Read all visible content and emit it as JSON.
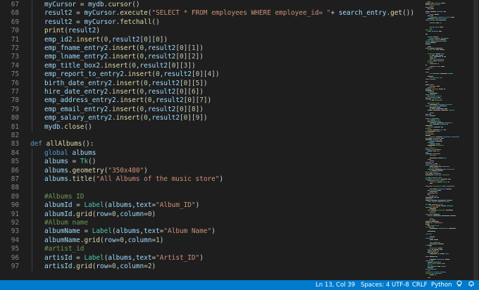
{
  "editor": {
    "lines": [
      {
        "num": "67",
        "indent": 1,
        "tokens": [
          [
            "var",
            "myCursor"
          ],
          [
            "p",
            " = "
          ],
          [
            "var",
            "mydb"
          ],
          [
            "p",
            "."
          ],
          [
            "fn",
            "cursor"
          ],
          [
            "p",
            "()"
          ]
        ]
      },
      {
        "num": "68",
        "indent": 1,
        "tokens": [
          [
            "var",
            "result2"
          ],
          [
            "p",
            " = "
          ],
          [
            "var",
            "myCursor"
          ],
          [
            "p",
            "."
          ],
          [
            "fn",
            "execute"
          ],
          [
            "p",
            "("
          ],
          [
            "str",
            "\"SELECT * FROM employees WHERE employee_id= \""
          ],
          [
            "p",
            "+ "
          ],
          [
            "var",
            "search_entry"
          ],
          [
            "p",
            "."
          ],
          [
            "fn",
            "get"
          ],
          [
            "p",
            "())"
          ]
        ]
      },
      {
        "num": "69",
        "indent": 1,
        "tokens": [
          [
            "var",
            "result2"
          ],
          [
            "p",
            " = "
          ],
          [
            "var",
            "myCursor"
          ],
          [
            "p",
            "."
          ],
          [
            "fn",
            "fetchall"
          ],
          [
            "p",
            "()"
          ]
        ]
      },
      {
        "num": "70",
        "indent": 1,
        "tokens": [
          [
            "fn",
            "print"
          ],
          [
            "p",
            "("
          ],
          [
            "var",
            "result2"
          ],
          [
            "p",
            ")"
          ]
        ]
      },
      {
        "num": "71",
        "indent": 1,
        "tokens": [
          [
            "var",
            "emp_id2"
          ],
          [
            "p",
            "."
          ],
          [
            "fn",
            "insert"
          ],
          [
            "p",
            "("
          ],
          [
            "num",
            "0"
          ],
          [
            "p",
            ","
          ],
          [
            "var",
            "result2"
          ],
          [
            "p",
            "["
          ],
          [
            "num",
            "0"
          ],
          [
            "p",
            "]["
          ],
          [
            "num",
            "0"
          ],
          [
            "p",
            "])"
          ]
        ]
      },
      {
        "num": "72",
        "indent": 1,
        "tokens": [
          [
            "var",
            "emp_fname_entry2"
          ],
          [
            "p",
            "."
          ],
          [
            "fn",
            "insert"
          ],
          [
            "p",
            "("
          ],
          [
            "num",
            "0"
          ],
          [
            "p",
            ","
          ],
          [
            "var",
            "result2"
          ],
          [
            "p",
            "["
          ],
          [
            "num",
            "0"
          ],
          [
            "p",
            "]["
          ],
          [
            "num",
            "1"
          ],
          [
            "p",
            "])"
          ]
        ]
      },
      {
        "num": "73",
        "indent": 1,
        "tokens": [
          [
            "var",
            "emp_lname_entry2"
          ],
          [
            "p",
            "."
          ],
          [
            "fn",
            "insert"
          ],
          [
            "p",
            "("
          ],
          [
            "num",
            "0"
          ],
          [
            "p",
            ","
          ],
          [
            "var",
            "result2"
          ],
          [
            "p",
            "["
          ],
          [
            "num",
            "0"
          ],
          [
            "p",
            "]["
          ],
          [
            "num",
            "2"
          ],
          [
            "p",
            "])"
          ]
        ]
      },
      {
        "num": "74",
        "indent": 1,
        "tokens": [
          [
            "var",
            "emp_title_box2"
          ],
          [
            "p",
            "."
          ],
          [
            "fn",
            "insert"
          ],
          [
            "p",
            "("
          ],
          [
            "num",
            "0"
          ],
          [
            "p",
            ","
          ],
          [
            "var",
            "result2"
          ],
          [
            "p",
            "["
          ],
          [
            "num",
            "0"
          ],
          [
            "p",
            "]["
          ],
          [
            "num",
            "3"
          ],
          [
            "p",
            "])"
          ]
        ]
      },
      {
        "num": "75",
        "indent": 1,
        "tokens": [
          [
            "var",
            "emp_report_to_entry2"
          ],
          [
            "p",
            "."
          ],
          [
            "fn",
            "insert"
          ],
          [
            "p",
            "("
          ],
          [
            "num",
            "0"
          ],
          [
            "p",
            ","
          ],
          [
            "var",
            "result2"
          ],
          [
            "p",
            "["
          ],
          [
            "num",
            "0"
          ],
          [
            "p",
            "]["
          ],
          [
            "num",
            "4"
          ],
          [
            "p",
            "])"
          ]
        ]
      },
      {
        "num": "76",
        "indent": 1,
        "tokens": [
          [
            "var",
            "birth_date_entry2"
          ],
          [
            "p",
            "."
          ],
          [
            "fn",
            "insert"
          ],
          [
            "p",
            "("
          ],
          [
            "num",
            "0"
          ],
          [
            "p",
            ","
          ],
          [
            "var",
            "result2"
          ],
          [
            "p",
            "["
          ],
          [
            "num",
            "0"
          ],
          [
            "p",
            "]["
          ],
          [
            "num",
            "5"
          ],
          [
            "p",
            "])"
          ]
        ]
      },
      {
        "num": "77",
        "indent": 1,
        "tokens": [
          [
            "var",
            "hire_date_entry2"
          ],
          [
            "p",
            "."
          ],
          [
            "fn",
            "insert"
          ],
          [
            "p",
            "("
          ],
          [
            "num",
            "0"
          ],
          [
            "p",
            ","
          ],
          [
            "var",
            "result2"
          ],
          [
            "p",
            "["
          ],
          [
            "num",
            "0"
          ],
          [
            "p",
            "]["
          ],
          [
            "num",
            "6"
          ],
          [
            "p",
            "])"
          ]
        ]
      },
      {
        "num": "78",
        "indent": 1,
        "tokens": [
          [
            "var",
            "emp_address_entry2"
          ],
          [
            "p",
            "."
          ],
          [
            "fn",
            "insert"
          ],
          [
            "p",
            "("
          ],
          [
            "num",
            "0"
          ],
          [
            "p",
            ","
          ],
          [
            "var",
            "result2"
          ],
          [
            "p",
            "["
          ],
          [
            "num",
            "0"
          ],
          [
            "p",
            "]["
          ],
          [
            "num",
            "7"
          ],
          [
            "p",
            "])"
          ]
        ]
      },
      {
        "num": "79",
        "indent": 1,
        "tokens": [
          [
            "var",
            "emp_email_entry2"
          ],
          [
            "p",
            "."
          ],
          [
            "fn",
            "insert"
          ],
          [
            "p",
            "("
          ],
          [
            "num",
            "0"
          ],
          [
            "p",
            ","
          ],
          [
            "var",
            "result2"
          ],
          [
            "p",
            "["
          ],
          [
            "num",
            "0"
          ],
          [
            "p",
            "]["
          ],
          [
            "num",
            "8"
          ],
          [
            "p",
            "])"
          ]
        ]
      },
      {
        "num": "80",
        "indent": 1,
        "tokens": [
          [
            "var",
            "emp_salary_entry2"
          ],
          [
            "p",
            "."
          ],
          [
            "fn",
            "insert"
          ],
          [
            "p",
            "("
          ],
          [
            "num",
            "0"
          ],
          [
            "p",
            ","
          ],
          [
            "var",
            "result2"
          ],
          [
            "p",
            "["
          ],
          [
            "num",
            "0"
          ],
          [
            "p",
            "]["
          ],
          [
            "num",
            "9"
          ],
          [
            "p",
            "])"
          ]
        ]
      },
      {
        "num": "81",
        "indent": 1,
        "tokens": [
          [
            "var",
            "mydb"
          ],
          [
            "p",
            "."
          ],
          [
            "fn",
            "close"
          ],
          [
            "p",
            "()"
          ]
        ]
      },
      {
        "num": "82",
        "indent": 0,
        "tokens": []
      },
      {
        "num": "83",
        "indent": 0,
        "tokens": [
          [
            "kw",
            "def"
          ],
          [
            "p",
            " "
          ],
          [
            "fn",
            "allAlbums"
          ],
          [
            "p",
            "():"
          ]
        ]
      },
      {
        "num": "84",
        "indent": 1,
        "tokens": [
          [
            "kw",
            "global"
          ],
          [
            "p",
            " "
          ],
          [
            "var",
            "albums"
          ]
        ]
      },
      {
        "num": "85",
        "indent": 1,
        "tokens": [
          [
            "var",
            "albums"
          ],
          [
            "p",
            " = "
          ],
          [
            "cls",
            "Tk"
          ],
          [
            "p",
            "()"
          ]
        ]
      },
      {
        "num": "86",
        "indent": 1,
        "tokens": [
          [
            "var",
            "albums"
          ],
          [
            "p",
            "."
          ],
          [
            "fn",
            "geometry"
          ],
          [
            "p",
            "("
          ],
          [
            "str",
            "\"350x480\""
          ],
          [
            "p",
            ")"
          ]
        ]
      },
      {
        "num": "87",
        "indent": 1,
        "tokens": [
          [
            "var",
            "albums"
          ],
          [
            "p",
            "."
          ],
          [
            "fn",
            "title"
          ],
          [
            "p",
            "("
          ],
          [
            "str",
            "\"All Albums of the music store\""
          ],
          [
            "p",
            ")"
          ]
        ]
      },
      {
        "num": "88",
        "indent": 1,
        "tokens": []
      },
      {
        "num": "89",
        "indent": 1,
        "tokens": [
          [
            "cmt",
            "#Albums ID"
          ]
        ]
      },
      {
        "num": "90",
        "indent": 1,
        "tokens": [
          [
            "var",
            "albumId"
          ],
          [
            "p",
            " = "
          ],
          [
            "cls",
            "Label"
          ],
          [
            "p",
            "("
          ],
          [
            "var",
            "albums"
          ],
          [
            "p",
            ","
          ],
          [
            "var",
            "text"
          ],
          [
            "p",
            "="
          ],
          [
            "str",
            "\"Album_ID\""
          ],
          [
            "p",
            ")"
          ]
        ]
      },
      {
        "num": "91",
        "indent": 1,
        "tokens": [
          [
            "var",
            "albumId"
          ],
          [
            "p",
            "."
          ],
          [
            "fn",
            "grid"
          ],
          [
            "p",
            "("
          ],
          [
            "var",
            "row"
          ],
          [
            "p",
            "="
          ],
          [
            "num",
            "0"
          ],
          [
            "p",
            ","
          ],
          [
            "var",
            "column"
          ],
          [
            "p",
            "="
          ],
          [
            "num",
            "0"
          ],
          [
            "p",
            ")"
          ]
        ]
      },
      {
        "num": "92",
        "indent": 1,
        "tokens": [
          [
            "cmt",
            "#Album name"
          ]
        ]
      },
      {
        "num": "93",
        "indent": 1,
        "tokens": [
          [
            "var",
            "albumName"
          ],
          [
            "p",
            " = "
          ],
          [
            "cls",
            "Label"
          ],
          [
            "p",
            "("
          ],
          [
            "var",
            "albums"
          ],
          [
            "p",
            ","
          ],
          [
            "var",
            "text"
          ],
          [
            "p",
            "="
          ],
          [
            "str",
            "\"Album Name\""
          ],
          [
            "p",
            ")"
          ]
        ]
      },
      {
        "num": "94",
        "indent": 1,
        "tokens": [
          [
            "var",
            "albumName"
          ],
          [
            "p",
            "."
          ],
          [
            "fn",
            "grid"
          ],
          [
            "p",
            "("
          ],
          [
            "var",
            "row"
          ],
          [
            "p",
            "="
          ],
          [
            "num",
            "0"
          ],
          [
            "p",
            ","
          ],
          [
            "var",
            "column"
          ],
          [
            "p",
            "="
          ],
          [
            "num",
            "1"
          ],
          [
            "p",
            ")"
          ]
        ]
      },
      {
        "num": "95",
        "indent": 1,
        "tokens": [
          [
            "cmt",
            "#artist_id"
          ]
        ]
      },
      {
        "num": "96",
        "indent": 1,
        "tokens": [
          [
            "var",
            "artisId"
          ],
          [
            "p",
            " = "
          ],
          [
            "cls",
            "Label"
          ],
          [
            "p",
            "("
          ],
          [
            "var",
            "albums"
          ],
          [
            "p",
            ","
          ],
          [
            "var",
            "text"
          ],
          [
            "p",
            "="
          ],
          [
            "str",
            "\"Artist_ID\""
          ],
          [
            "p",
            ")"
          ]
        ]
      },
      {
        "num": "97",
        "indent": 1,
        "tokens": [
          [
            "var",
            "artisId"
          ],
          [
            "p",
            "."
          ],
          [
            "fn",
            "grid"
          ],
          [
            "p",
            "("
          ],
          [
            "var",
            "row"
          ],
          [
            "p",
            "="
          ],
          [
            "num",
            "0"
          ],
          [
            "p",
            ","
          ],
          [
            "var",
            "column"
          ],
          [
            "p",
            "="
          ],
          [
            "num",
            "2"
          ],
          [
            "p",
            ")"
          ]
        ]
      }
    ]
  },
  "statusbar": {
    "cursor_position": "Ln 13, Col 39",
    "indentation": "Spaces: 4",
    "encoding": "UTF-8",
    "line_ending": "CRLF",
    "language": "Python"
  },
  "colors": {
    "background": "#1e1e1e",
    "statusbar": "#007acc"
  }
}
